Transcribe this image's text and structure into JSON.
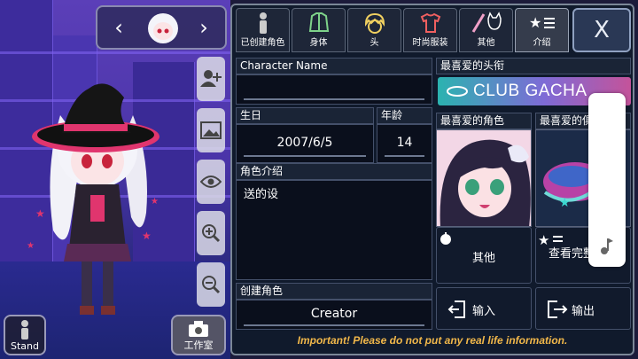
{
  "scene": {
    "stand_label": "Stand",
    "studio_label": "工作室",
    "prev_icon": "chevron-left-icon",
    "next_icon": "chevron-right-icon"
  },
  "tabs": [
    {
      "label": "已创建角色",
      "icon": "character-silhouette-icon"
    },
    {
      "label": "身体",
      "icon": "shirt-body-icon"
    },
    {
      "label": "头",
      "icon": "head-hair-icon"
    },
    {
      "label": "时尚服装",
      "icon": "tshirt-icon"
    },
    {
      "label": "其他",
      "icon": "sword-cat-icon"
    },
    {
      "label": "介绍",
      "icon": "star-list-icon"
    }
  ],
  "close_label": "X",
  "fields": {
    "name_label": "Character Name",
    "name_value": "",
    "birthday_label": "生日",
    "birthday_value": "2007/6/5",
    "age_label": "年龄",
    "age_value": "14",
    "intro_label": "角色介绍",
    "intro_value": "送的设",
    "creator_label": "创建角色",
    "creator_value": "Creator"
  },
  "favorites": {
    "title_label": "最喜爱的头衔",
    "title_value": "CLUB GACHA",
    "character_label": "最喜爱的角色",
    "item_label": "最喜爱的俱乐部"
  },
  "buttons": {
    "other": "其他",
    "view_full": "查看完整信息",
    "import": "输入",
    "export": "输出"
  },
  "footer": "Important! Please do not put any real life information.",
  "colors": {
    "panel_bg": "#101a2c",
    "warning": "#f2b84a",
    "scene_purple": "#4a34a8",
    "hat_pink": "#e0356e"
  }
}
